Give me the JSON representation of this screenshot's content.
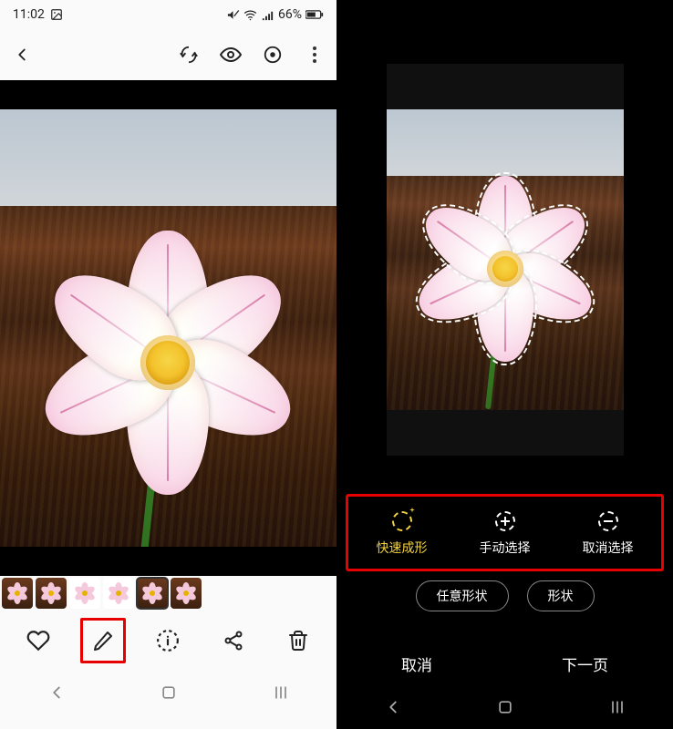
{
  "left": {
    "status": {
      "time": "11:02",
      "battery": "66%"
    },
    "thumbnails": [
      {
        "selected": false,
        "bg": "wood"
      },
      {
        "selected": false,
        "bg": "wood"
      },
      {
        "selected": false,
        "bg": "white"
      },
      {
        "selected": false,
        "bg": "white"
      },
      {
        "selected": true,
        "bg": "wood"
      },
      {
        "selected": false,
        "bg": "wood"
      }
    ]
  },
  "right": {
    "tools": {
      "quick": {
        "label": "快速成形",
        "active": true,
        "kind": "sparkle"
      },
      "manual": {
        "label": "手动选择",
        "active": false,
        "kind": "plus"
      },
      "cancel": {
        "label": "取消选择",
        "active": false,
        "kind": "minus"
      }
    },
    "pills": {
      "freeform": "任意形状",
      "shape": "形状"
    },
    "footer": {
      "cancel": "取消",
      "next": "下一页"
    }
  }
}
